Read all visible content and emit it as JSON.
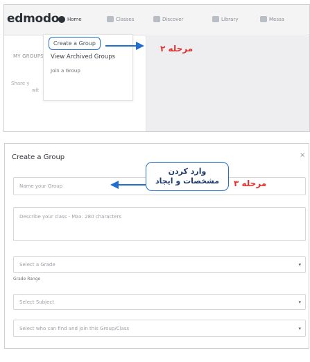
{
  "nav": {
    "logo": "edmodo",
    "items": [
      {
        "label": "Home"
      },
      {
        "label": "Classes"
      },
      {
        "label": "Discover"
      },
      {
        "label": "Library"
      },
      {
        "label": "Messa"
      }
    ]
  },
  "sidebar": {
    "my_groups": "MY GROUPS",
    "more": "...",
    "share_line1": "Share y",
    "share_line2": "wit"
  },
  "menu": {
    "create": "Create a Group",
    "archived": "View Archived Groups",
    "join": "Join a Group"
  },
  "annotations": {
    "step2": "مرحله ۲",
    "step3": "مرحله ۳",
    "callout_line1": "وارد کردن",
    "callout_line2": "مشخصات و ایجاد",
    "accent_color": "#1f6fd1",
    "step_color": "#e0312e"
  },
  "dialog": {
    "title": "Create a Group",
    "close": "×",
    "name_placeholder": "Name your Group",
    "desc_placeholder": "Describe your class - Max. 280 characters",
    "grade_select": "Select a Grade",
    "grade_range": "Grade Range",
    "subject_select": "Select Subject",
    "who_select": "Select who can find and join this Group/Class"
  }
}
